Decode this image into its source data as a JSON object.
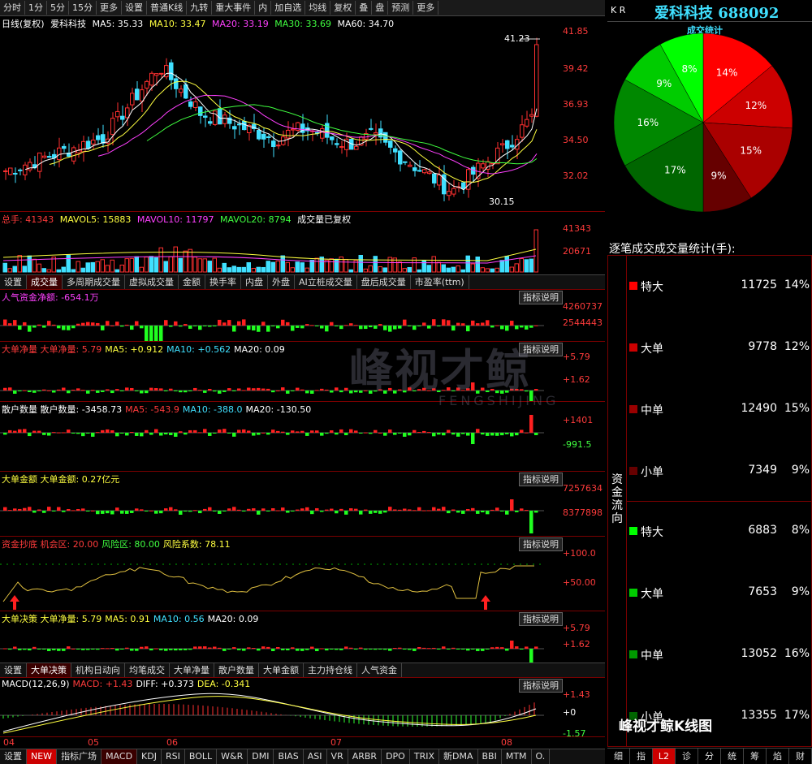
{
  "toolbar": {
    "items": [
      "分时",
      "1分",
      "5分",
      "15分",
      "更多",
      "设置",
      "普通K线",
      "九转",
      "重大事件",
      "内",
      "加自选",
      "均线",
      "复权",
      "叠",
      "盘",
      "预测",
      "更多"
    ]
  },
  "main_chart": {
    "header": {
      "title": "日线(复权)",
      "stock": "爱科科技",
      "ma5": "MA5: 35.33",
      "ma10": "MA10: 33.47",
      "ma20": "MA20: 33.19",
      "ma30": "MA30: 33.69",
      "ma60": "MA60: 34.70"
    },
    "axis": [
      "41.85",
      "39.42",
      "36.93",
      "34.50",
      "32.02"
    ],
    "high_label": "41.23",
    "low_label": "30.15"
  },
  "volume": {
    "header": {
      "label": "总手: 41343",
      "mavol5": "MAVOL5: 15883",
      "mavol10": "MAVOL10: 11797",
      "mavol20": "MAVOL20: 8794",
      "note": "成交量已复权"
    },
    "axis": [
      "41343",
      "20671"
    ]
  },
  "vol_tabs": [
    "设置",
    "成交量",
    "多周期成交量",
    "虚拟成交量",
    "金额",
    "换手率",
    "内盘",
    "外盘",
    "AI立桩成交量",
    "盘后成交量",
    "市盈率(ttm)"
  ],
  "ind1": {
    "header": "人气资金净额: -654.1万",
    "axis": [
      "4260737",
      "2544443"
    ]
  },
  "ind2": {
    "h1": "大单净量 大单净量: 5.79",
    "h2": "MA5: +0.912",
    "h3": "MA10: +0.562",
    "h4": "MA20: 0.09",
    "axis": [
      "+5.79",
      "+1.62"
    ]
  },
  "ind3": {
    "h1": "散户数量 散户数量: -3458.73",
    "h2": "MA5: -543.9",
    "h3": "MA10: -388.0",
    "h4": "MA20: -130.50",
    "axis": [
      "+1401",
      "-991.5"
    ]
  },
  "ind4": {
    "h1": "大单金额 大单金额: 0.27亿元",
    "axis": [
      "7257634",
      "8377898"
    ]
  },
  "ind5": {
    "h1": "资金抄底 机会区: 20.00",
    "h2": "风险区: 80.00",
    "h3": "风险系数: 78.11",
    "axis": [
      "+100.0",
      "+50.00"
    ]
  },
  "ind6": {
    "h1": "大单决策 大单净量: 5.79",
    "h2": "MA5: 0.91",
    "h3": "MA10: 0.56",
    "h4": "MA20: 0.09",
    "axis": [
      "+5.79",
      "+1.62"
    ]
  },
  "ind_tabs": [
    "设置",
    "大单决策",
    "机构日动向",
    "均笔成交",
    "大单净量",
    "散户数量",
    "大单金额",
    "主力持仓线",
    "人气资金"
  ],
  "macd": {
    "h1": "MACD(12,26,9)",
    "h2": "MACD: +1.43",
    "h3": "DIFF: +0.373",
    "h4": "DEA: -0.341",
    "axis": [
      "+1.43",
      "+0",
      "-1.57"
    ]
  },
  "months": [
    "04",
    "05",
    "06",
    "07",
    "08"
  ],
  "explain_label": "指标说明",
  "watermark": {
    "cn": "峰视才鲸",
    "en": "FENGSHIJING"
  },
  "bottom_bar": [
    "设置",
    "NEW",
    "指标广场",
    "MACD",
    "KDJ",
    "RSI",
    "BOLL",
    "W&R",
    "DMI",
    "BIAS",
    "ASI",
    "VR",
    "ARBR",
    "DPO",
    "TRIX",
    "新DMA",
    "BBI",
    "MTM",
    "O."
  ],
  "right": {
    "kr": "K R",
    "stock_title": "爱科科技 688092",
    "pie_title": "成交统计",
    "stats_title": "逐笔成交成交量统计(手):",
    "side_label": "资金流向",
    "rows": [
      {
        "name": "特大",
        "vol": "11725",
        "pct": "14%",
        "color": "#ff0000"
      },
      {
        "name": "大单",
        "vol": "9778",
        "pct": "12%",
        "color": "#cc0000"
      },
      {
        "name": "中单",
        "vol": "12490",
        "pct": "15%",
        "color": "#990000"
      },
      {
        "name": "小单",
        "vol": "7349",
        "pct": "9%",
        "color": "#660000"
      },
      {
        "name": "特大",
        "vol": "6883",
        "pct": "8%",
        "color": "#00ff00"
      },
      {
        "name": "大单",
        "vol": "7653",
        "pct": "9%",
        "color": "#00cc00"
      },
      {
        "name": "中单",
        "vol": "13052",
        "pct": "16%",
        "color": "#009900"
      },
      {
        "name": "小单",
        "vol": "13355",
        "pct": "17%",
        "color": "#006600"
      }
    ],
    "pie_slices": [
      14,
      12,
      15,
      9,
      17,
      16,
      9,
      8
    ],
    "pie_labels": [
      "14%",
      "12%",
      "15%",
      "9%",
      "17%",
      "16%",
      "9%",
      "8%"
    ],
    "pie_colors": [
      "#ff0000",
      "#cc0000",
      "#aa0000",
      "#660000",
      "#006600",
      "#008800",
      "#00cc00",
      "#00ff00"
    ],
    "bottom_tabs": [
      "细",
      "指",
      "L2",
      "诊",
      "分",
      "统",
      "筹",
      "焰",
      "财"
    ],
    "wechat": "峰视才鲸K线图"
  }
}
